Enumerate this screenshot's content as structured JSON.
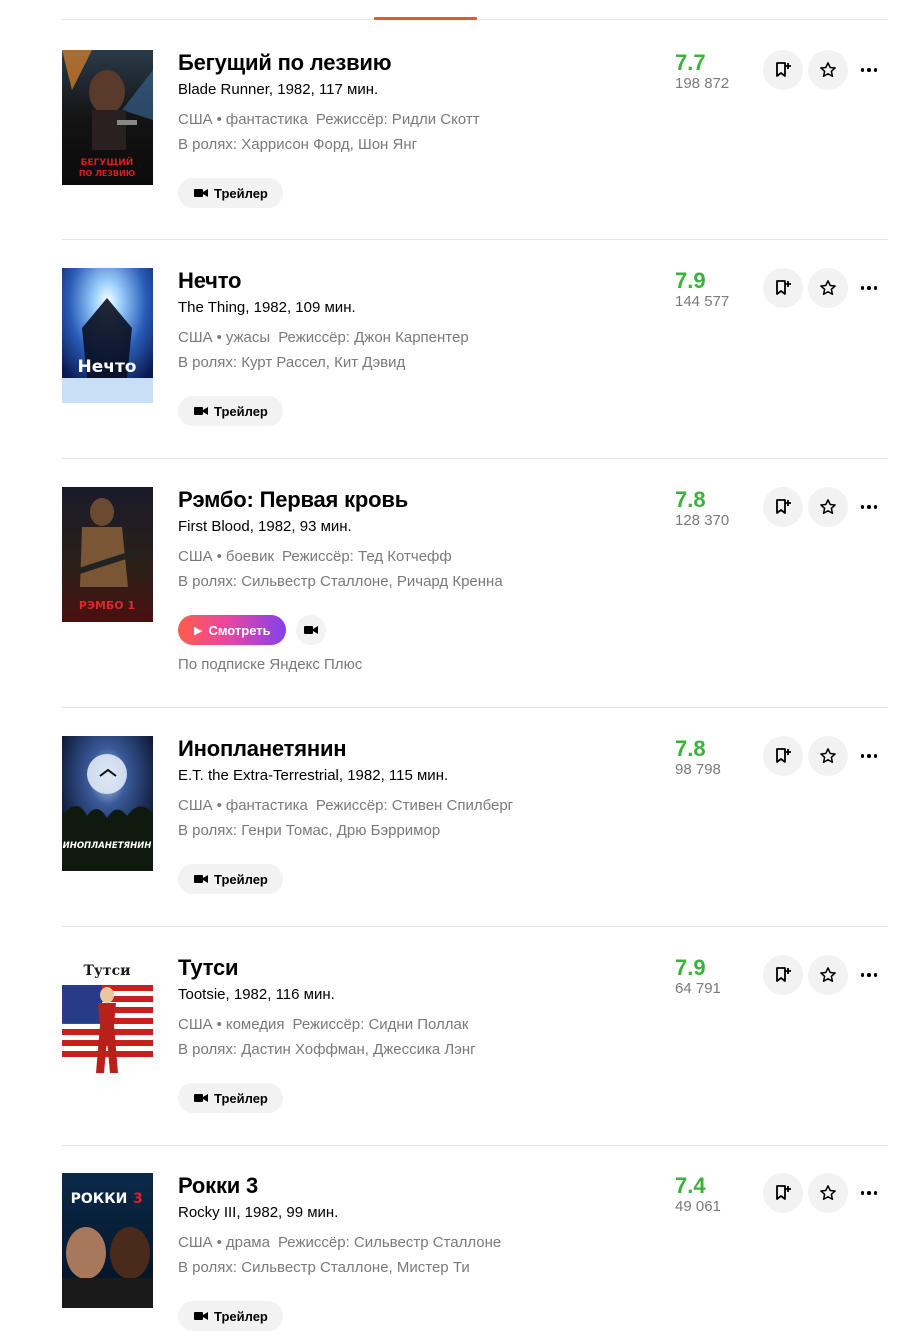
{
  "labels": {
    "trailer": "Трейлер",
    "watch": "Смотреть",
    "subscription_note": "По подписке Яндекс Плюс"
  },
  "colors": {
    "rating_green": "#3bb33b",
    "accent_orange": "#f0551e"
  },
  "icons": {
    "add_to_folder": "add-to-folder-icon",
    "star": "star-icon",
    "more": "more-dots-icon",
    "camera": "video-camera-icon",
    "play": "play-icon"
  },
  "films": [
    {
      "title": "Бегущий по лезвию",
      "original": "Blade Runner, 1982, 117 мин.",
      "country": "США",
      "genre": "фантастика",
      "director": "Режиссёр: Ридли Скотт",
      "cast": "В ролях: Харрисон Форд, Шон Янг",
      "rating": "7.7",
      "votes": "198 872",
      "poster_text": "БЕГУЩИЙ ПО ЛЕЗВИЮ"
    },
    {
      "title": "Нечто",
      "original": "The Thing, 1982, 109 мин.",
      "country": "США",
      "genre": "ужасы",
      "director": "Режиссёр: Джон Карпентер",
      "cast": "В ролях: Курт Рассел, Кит Дэвид",
      "rating": "7.9",
      "votes": "144 577",
      "poster_text": "Нечто"
    },
    {
      "title": "Рэмбо: Первая кровь",
      "original": "First Blood, 1982, 93 мин.",
      "country": "США",
      "genre": "боевик",
      "director": "Режиссёр: Тед Котчефф",
      "cast": "В ролях: Сильвестр Сталлоне, Ричард Кренна",
      "rating": "7.8",
      "votes": "128 370",
      "poster_text": "РЭМБО 1"
    },
    {
      "title": "Инопланетянин",
      "original": "E.T. the Extra-Terrestrial, 1982, 115 мин.",
      "country": "США",
      "genre": "фантастика",
      "director": "Режиссёр: Стивен Спилберг",
      "cast": "В ролях: Генри Томас, Дрю Бэрримор",
      "rating": "7.8",
      "votes": "98 798",
      "poster_text": "ИНОПЛАНЕТЯНИН"
    },
    {
      "title": "Тутси",
      "original": "Tootsie, 1982, 116 мин.",
      "country": "США",
      "genre": "комедия",
      "director": "Режиссёр: Сидни Поллак",
      "cast": "В ролях: Дастин Хоффман, Джессика Лэнг",
      "rating": "7.9",
      "votes": "64 791",
      "poster_text": "Тутси"
    },
    {
      "title": "Рокки 3",
      "original": "Rocky III, 1982, 99 мин.",
      "country": "США",
      "genre": "драма",
      "director": "Режиссёр: Сильвестр Сталлоне",
      "cast": "В ролях: Сильвестр Сталлоне, Мистер Ти",
      "rating": "7.4",
      "votes": "49 061",
      "poster_text": "РОККИ 3"
    }
  ]
}
